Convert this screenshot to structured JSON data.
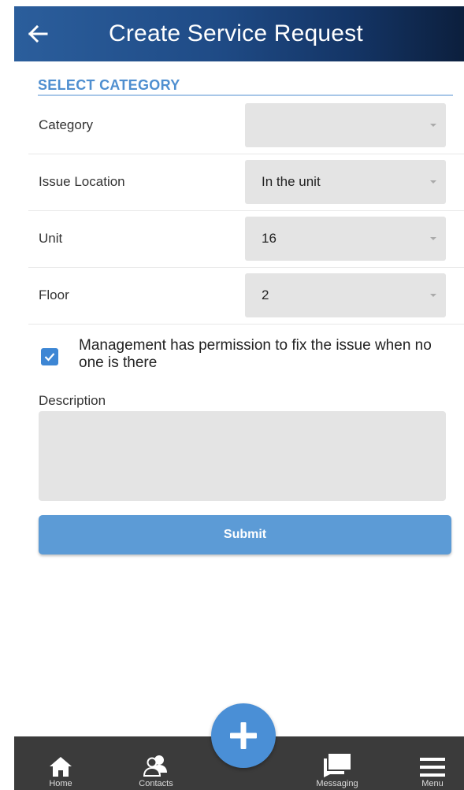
{
  "header": {
    "title": "Create Service Request",
    "back_icon": "arrow-left-icon",
    "gradient_colors": [
      "#2b5e9c",
      "#0c1f3d"
    ]
  },
  "section": {
    "title": "SELECT CATEGORY"
  },
  "fields": [
    {
      "label": "Category",
      "value": ""
    },
    {
      "label": "Issue Location",
      "value": "In the unit"
    },
    {
      "label": "Unit",
      "value": "16"
    },
    {
      "label": "Floor",
      "value": "2"
    }
  ],
  "permission": {
    "checked": true,
    "text": "Management has permission to fix the issue when no one is there"
  },
  "description": {
    "label": "Description",
    "value": ""
  },
  "submit": {
    "label": "Submit",
    "color": "#5c9bd6"
  },
  "bottom_nav": {
    "items": [
      {
        "label": "Home",
        "icon": "home-icon"
      },
      {
        "label": "Contacts",
        "icon": "contacts-icon"
      },
      {
        "label": "Messaging",
        "icon": "messaging-icon"
      },
      {
        "label": "Menu",
        "icon": "hamburger-menu-icon"
      }
    ],
    "fab_icon": "plus-icon"
  }
}
